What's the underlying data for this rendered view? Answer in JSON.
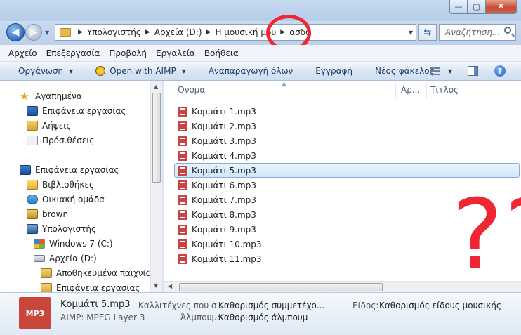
{
  "window": {
    "min_glyph": "—",
    "max_glyph": "▢",
    "close_glyph": "✕"
  },
  "address": {
    "crumbs": [
      "Υπολογιστής",
      "Αρχεία (D:)",
      "Η μουσική μου",
      "ασδφ"
    ],
    "search_placeholder": "Αναζήτηση..."
  },
  "menu": [
    "Αρχείο",
    "Επεξεργασία",
    "Προβολή",
    "Εργαλεία",
    "Βοήθεια"
  ],
  "commands": {
    "organize": "Οργάνωση",
    "open_with": "Open with AIMP",
    "play_all": "Αναπαραγωγή όλων",
    "burn": "Εγγραφή",
    "new_folder": "Νέος φάκελος",
    "help": "?"
  },
  "nav_tree": {
    "favorites": "Αγαπημένα",
    "fav_items": [
      "Επιφάνεια εργασίας",
      "Λήψεις",
      "Πρόσ.θέσεις"
    ],
    "desktop": "Επιφάνεια εργασίας",
    "libraries": "Βιβλιοθήκες",
    "homegroup": "Οικιακή ομάδα",
    "user": "brown",
    "computer": "Υπολογιστής",
    "drive_c": "Windows 7 (C:)",
    "drive_d": "Αρχεία (D:)",
    "saved_games": "Αποθηκευμένα παιχνίδια",
    "desktop_folder": "Επιφάνεια εργασίας"
  },
  "columns": {
    "name": "Όνομα",
    "number": "Αρ...",
    "title": "Τίτλος"
  },
  "files": [
    "Κομμάτι 1.mp3",
    "Κομμάτι 2.mp3",
    "Κομμάτι 3.mp3",
    "Κομμάτι 4.mp3",
    "Κομμάτι 5.mp3",
    "Κομμάτι 6.mp3",
    "Κομμάτι 7.mp3",
    "Κομμάτι 8.mp3",
    "Κομμάτι 9.mp3",
    "Κομμάτι 10.mp3",
    "Κομμάτι 11.mp3"
  ],
  "selected_index": 4,
  "annotation": {
    "text": "???",
    "color": "#ee2733"
  },
  "details": {
    "icon_label": "MP3",
    "file_name": "Κομμάτι 5.mp3",
    "file_type": "AIMP: MPEG Layer 3",
    "artists_label": "Καλλιτέχνες που σ...",
    "artists_value": "Καθορισμός συμμετέχο...",
    "album_label": "Άλμπουμ:",
    "album_value": "Καθορισμός άλμπουμ",
    "genre_label": "Είδος:",
    "genre_value": "Καθορισμός είδους μουσικής"
  },
  "colors": {
    "accent": "#2b6cc4",
    "selection": "#cfe6fb",
    "mp3": "#c94343"
  }
}
